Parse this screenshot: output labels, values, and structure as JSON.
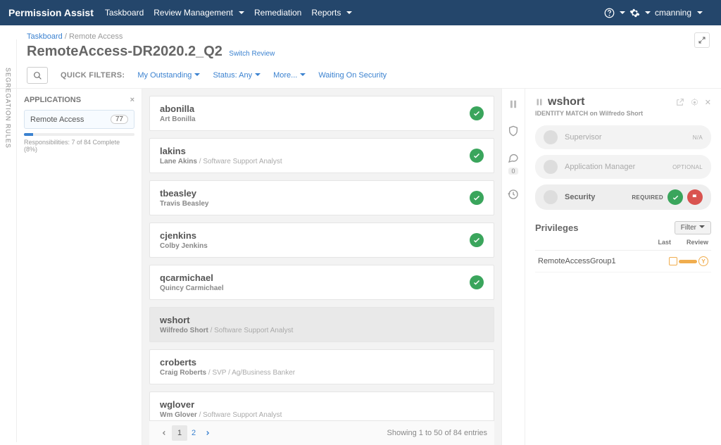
{
  "nav": {
    "brand": "Permission Assist",
    "items": [
      "Taskboard",
      "Review Management",
      "Remediation",
      "Reports"
    ],
    "user": "cmanning"
  },
  "breadcrumb": {
    "root": "Taskboard",
    "current": "Remote Access"
  },
  "page": {
    "title": "RemoteAccess-DR2020.2_Q2",
    "switch": "Switch Review"
  },
  "quickfilters": {
    "label": "QUICK FILTERS:",
    "items": [
      "My Outstanding",
      "Status: Any",
      "More...",
      "Waiting On Security"
    ]
  },
  "vtab": "SEGREGATION RULES",
  "apps": {
    "heading": "APPLICATIONS",
    "item": "Remote Access",
    "count": "77",
    "progress_pct": 8,
    "progress_label": "Responsibilities: 7 of 84 Complete (8%)"
  },
  "users": [
    {
      "username": "abonilla",
      "fullname": "Art Bonilla",
      "role": "",
      "done": true
    },
    {
      "username": "lakins",
      "fullname": "Lane Akins",
      "role": "Software Support Analyst",
      "done": true
    },
    {
      "username": "tbeasley",
      "fullname": "Travis Beasley",
      "role": "",
      "done": true
    },
    {
      "username": "cjenkins",
      "fullname": "Colby Jenkins",
      "role": "",
      "done": true
    },
    {
      "username": "qcarmichael",
      "fullname": "Quincy Carmichael",
      "role": "",
      "done": true
    },
    {
      "username": "wshort",
      "fullname": "Wilfredo Short",
      "role": "Software Support Analyst",
      "done": false,
      "selected": true
    },
    {
      "username": "croberts",
      "fullname": "Craig Roberts",
      "role": "SVP / Ag/Business Banker",
      "done": false
    },
    {
      "username": "wglover",
      "fullname": "Wm Glover",
      "role": "Software Support Analyst",
      "done": false
    }
  ],
  "pager": {
    "current": "1",
    "next": "2",
    "info": "Showing 1 to 50 of 84 entries"
  },
  "rail": {
    "comment_count": "0"
  },
  "detail": {
    "username": "wshort",
    "identity_prefix": "IDENTITY MATCH on ",
    "identity_name": "Wilfredo Short",
    "roles": [
      {
        "name": "Supervisor",
        "status": "N/A",
        "active": false
      },
      {
        "name": "Application Manager",
        "status": "OPTIONAL",
        "active": false
      },
      {
        "name": "Security",
        "status": "REQUIRED",
        "active": true
      }
    ],
    "privs_heading": "Privileges",
    "filter_label": "Filter",
    "col_last": "Last",
    "col_review": "Review",
    "privileges": [
      {
        "name": "RemoteAccessGroup1",
        "review": "Y"
      }
    ]
  }
}
